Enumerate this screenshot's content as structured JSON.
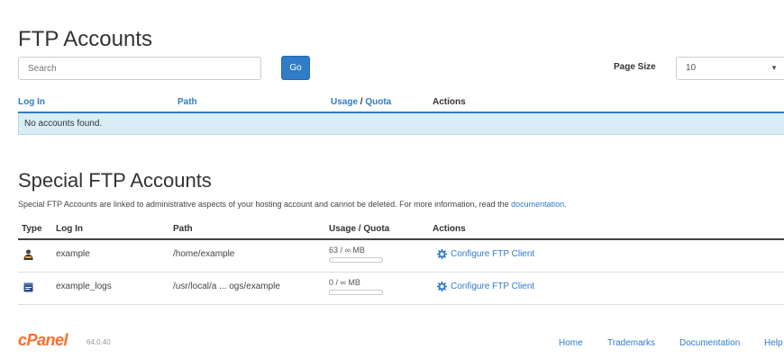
{
  "ftp_accounts": {
    "title": "FTP Accounts",
    "search_placeholder": "Search",
    "go_label": "Go",
    "page_size_label": "Page Size",
    "page_size_value": "10",
    "columns": {
      "login": "Log In",
      "path": "Path",
      "usage": "Usage",
      "usage_sep": " / ",
      "quota": "Quota",
      "actions": "Actions"
    },
    "empty_message": "No accounts found."
  },
  "special_ftp": {
    "title": "Special FTP Accounts",
    "description": "Special FTP Accounts are linked to administrative aspects of your hosting account and cannot be deleted. For more information, read the ",
    "doc_link": "documentation",
    "description_end": ".",
    "columns": {
      "type": "Type",
      "login": "Log In",
      "path": "Path",
      "usage_quota": "Usage / Quota",
      "actions": "Actions"
    },
    "rows": [
      {
        "type_icon": "user-icon",
        "login": "example",
        "path": "/home/example",
        "usage": "63 / ∞ MB",
        "usage_fraction": 0,
        "action_label": "Configure FTP Client"
      },
      {
        "type_icon": "logs-icon",
        "login": "example_logs",
        "path": "/usr/local/a ... ogs/example",
        "usage": "0 / ∞ MB",
        "usage_fraction": 0,
        "action_label": "Configure FTP Client"
      }
    ]
  },
  "footer": {
    "logo": "cPanel",
    "version": "64.0.40",
    "links": [
      "Home",
      "Trademarks",
      "Documentation",
      "Help"
    ]
  },
  "colors": {
    "accent": "#2f7cc8",
    "info_bg": "#d9edf7",
    "logo": "#ff6c2c"
  }
}
